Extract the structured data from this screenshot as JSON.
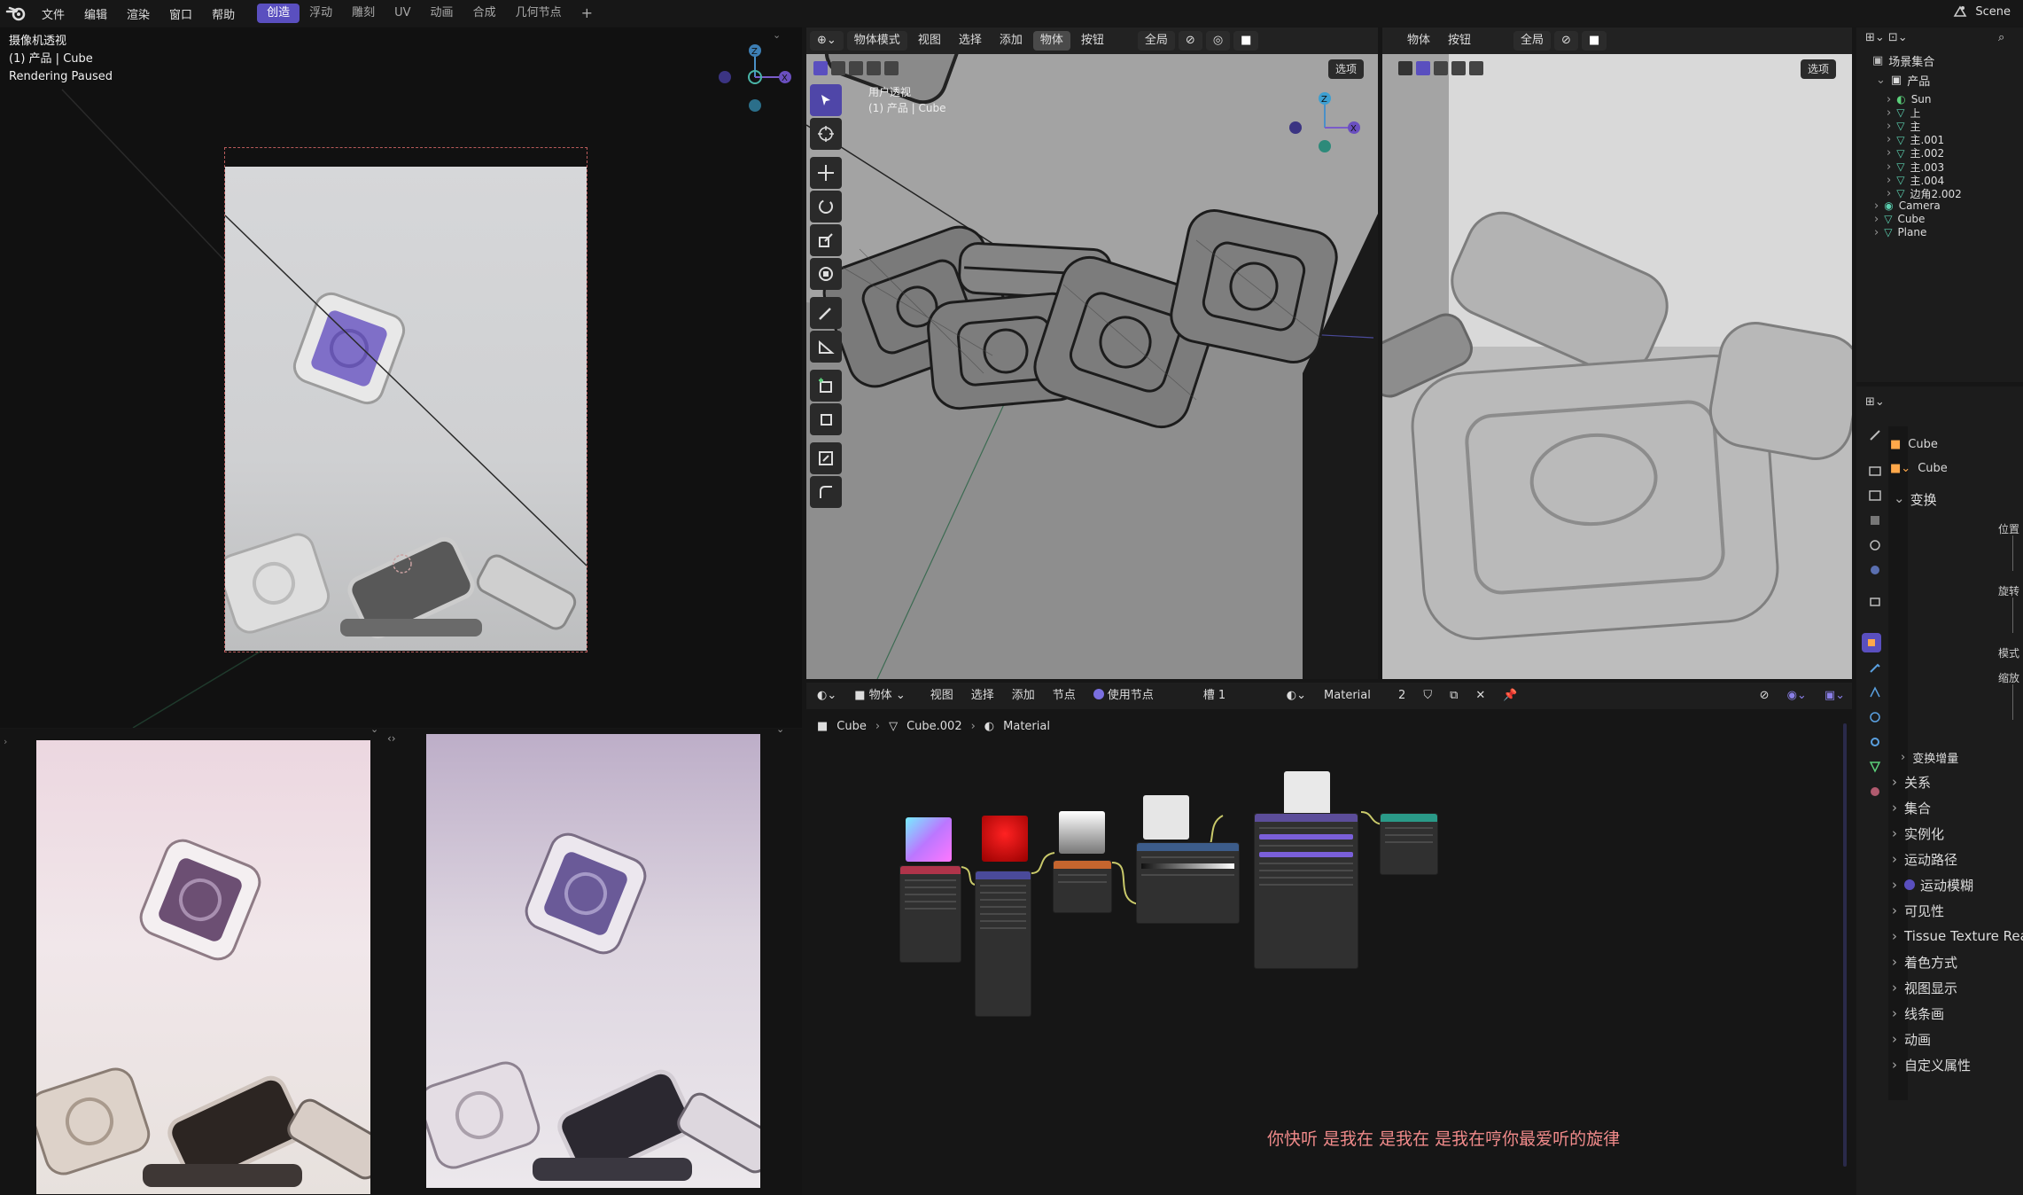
{
  "topbar": {
    "menus": [
      "文件",
      "编辑",
      "渲染",
      "窗口",
      "帮助"
    ],
    "workspaces": [
      "创造",
      "浮动",
      "雕刻",
      "UV",
      "动画",
      "合成",
      "几何节点"
    ],
    "active_workspace": "创造",
    "add_tab": "+",
    "scene": "Scene"
  },
  "camera_view": {
    "title": "摄像机透视",
    "object": "(1) 产品 | Cube",
    "status": "Rendering Paused"
  },
  "gizmo": {
    "z": "Z",
    "x": "X"
  },
  "viewport3d": {
    "mode": "物体模式",
    "menus": [
      "视图",
      "选择",
      "添加",
      "物体",
      "按钮"
    ],
    "transform": "全局",
    "options": "选项",
    "overlay_title": "用户透视",
    "overlay_object": "(1) 产品 | Cube"
  },
  "viewport_right": {
    "menus": [
      "物体",
      "按钮"
    ],
    "transform": "全局",
    "options": "选项"
  },
  "outliner": {
    "root": "场景集合",
    "collection": "产品",
    "items": [
      "Sun",
      "上",
      "主",
      "主.001",
      "主.002",
      "主.003",
      "主.004",
      "边角2.002"
    ],
    "top_items": [
      "Camera",
      "Cube",
      "Plane"
    ]
  },
  "properties": {
    "object_name": "Cube",
    "data_name": "Cube",
    "section_transform": "变换",
    "field_labels": [
      "位置 X",
      "旋转 X",
      "模式",
      "缩放 X"
    ],
    "sections": [
      "变换增量",
      "关系",
      "集合",
      "实例化",
      "运动路径",
      "运动模糊",
      "可见性",
      "Tissue Texture Rea",
      "着色方式",
      "视图显示",
      "线条画",
      "动画",
      "自定义属性"
    ]
  },
  "node_editor": {
    "type": "物体",
    "menus": [
      "视图",
      "选择",
      "添加",
      "节点"
    ],
    "use_nodes": "使用节点",
    "slot": "槽 1",
    "material": "Material",
    "users": "2",
    "breadcrumb": [
      "Cube",
      "Cube.002",
      "Material"
    ]
  },
  "subtitle": "你快听 是我在 是我在 是我在哼你最爱听的旋律",
  "colors": {
    "accent": "#5a4fbf",
    "subtitle": "#f08a8a",
    "header": "#1c1c1c",
    "panel": "#101010"
  }
}
